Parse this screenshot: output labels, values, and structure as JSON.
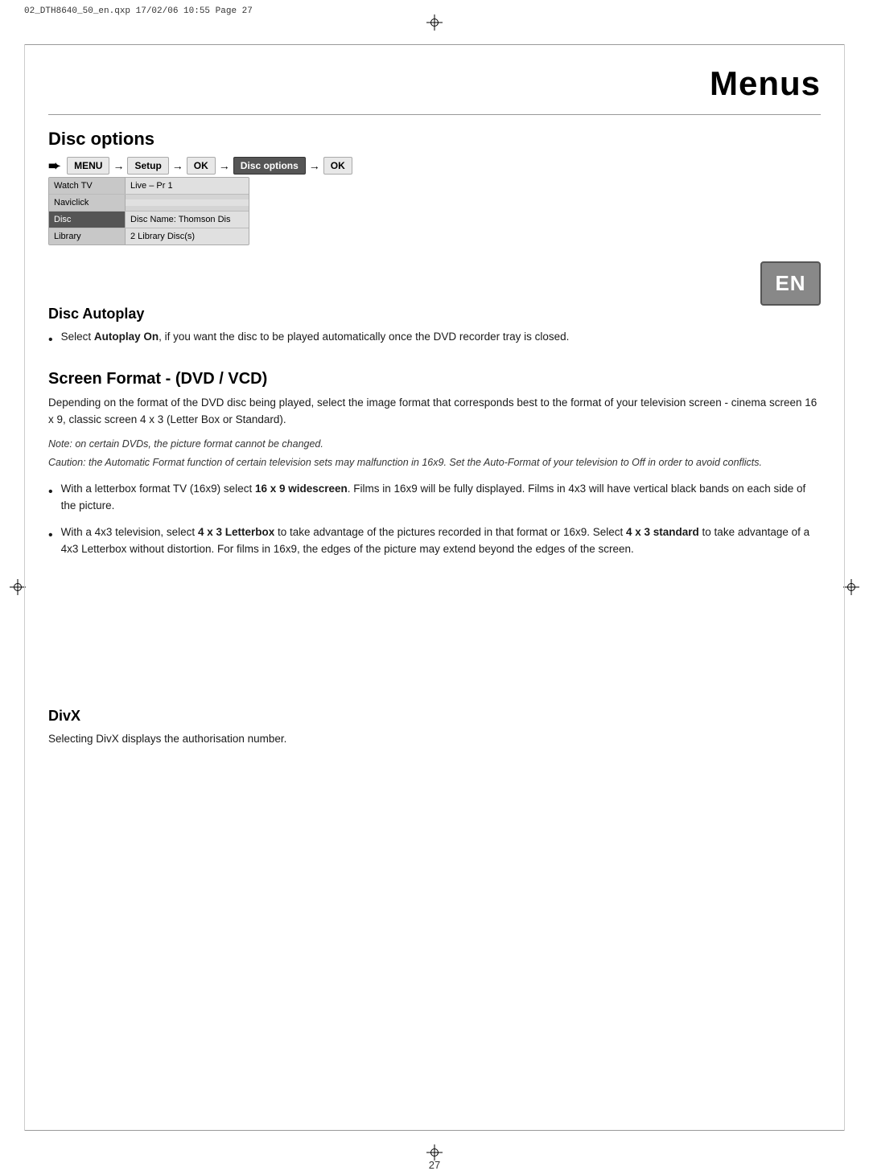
{
  "printer_marks": {
    "text": "02_DTH8640_50_en.qxp  17/02/06  10:55  Page 27"
  },
  "page_title": "Menus",
  "section_heading": "Disc options",
  "menu_nav": {
    "arrow": "➨",
    "items": [
      "MENU",
      "Setup",
      "OK",
      "Disc options",
      "OK"
    ],
    "separators": [
      "→",
      "→",
      "→",
      "→"
    ]
  },
  "screen_menu": {
    "rows": [
      {
        "label": "Watch TV",
        "value": "Live – Pr 1",
        "highlighted": false
      },
      {
        "label": "Naviclick",
        "value": "",
        "highlighted": false
      },
      {
        "label": "Disc",
        "value": "Disc Name: Thomson Dis",
        "highlighted": true
      },
      {
        "label": "Library",
        "value": "2 Library Disc(s)",
        "highlighted": false
      }
    ]
  },
  "en_badge": "EN",
  "disc_autoplay": {
    "heading": "Disc Autoplay",
    "bullet": "Select Autoplay On, if you want the disc to be played automatically once the DVD recorder tray is closed.",
    "bullet_bold_part": "Autoplay On"
  },
  "screen_format": {
    "heading": "Screen Format - (DVD / VCD)",
    "body": "Depending on the format of the DVD disc being played, select the image format that corresponds best to the format of your television screen - cinema screen 16 x 9, classic screen 4 x 3 (Letter Box or Standard).",
    "note1": "Note: on certain DVDs, the picture format cannot be changed.",
    "note2": "Caution: the Automatic Format function of certain television sets may malfunction in 16x9. Set the Auto-Format of your television to Off in order to avoid conflicts.",
    "bullet1": "With a letterbox format TV (16x9) select 16 x 9 widescreen. Films in 16x9 will be fully displayed. Films in 4x3 will have vertical black bands on each side of the picture.",
    "bullet1_bold": "16 x 9 widescreen",
    "bullet2": "With a 4x3 television, select 4 x 3 Letterbox to take advantage of the pictures recorded in that format or 16x9. Select 4 x 3 standard to take advantage of a 4x3 Letterbox without distortion. For films in 16x9, the edges of the picture may extend beyond the edges of the screen.",
    "bullet2_bold1": "4 x 3 Letterbox",
    "bullet2_bold2": "4 x 3 standard"
  },
  "divx": {
    "heading": "DivX",
    "body": "Selecting DivX displays the authorisation number."
  },
  "page_number": "27"
}
